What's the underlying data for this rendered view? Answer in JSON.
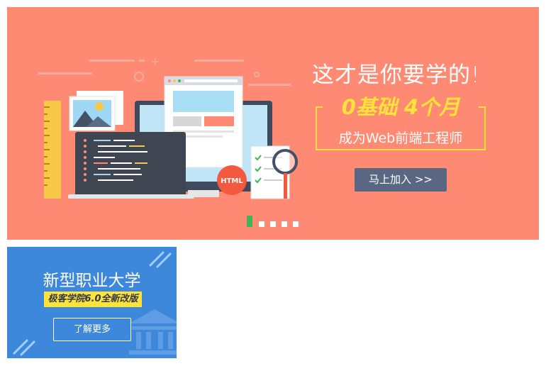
{
  "banner": {
    "headline": "这才是你要学的!",
    "subheadline": "0基础 4个月",
    "tagline": "成为Web前端工程师",
    "cta_label": "马上加入 >>",
    "html_badge": "HTML",
    "slides_total": 5,
    "active_slide": 1,
    "colors": {
      "background": "#fe8a74",
      "accent": "#ffe23a",
      "cta": "#596782",
      "active_dot": "#3cb556"
    }
  },
  "promo": {
    "title": "新型职业大学",
    "tag": "极客学院6.0全新改版",
    "button_label": "了解更多",
    "colors": {
      "background": "#3e88db",
      "accent": "#ffe23a"
    }
  }
}
